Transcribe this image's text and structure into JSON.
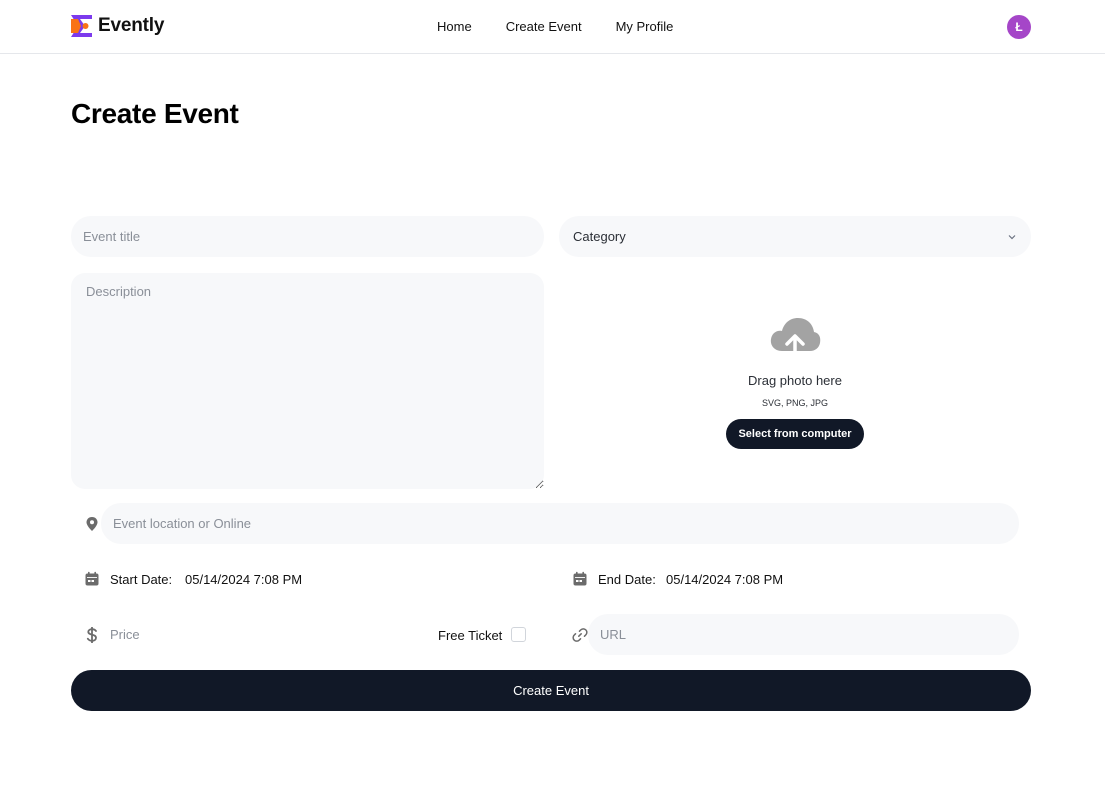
{
  "app": {
    "brand": "Evently",
    "brand_colors": [
      "#f97316",
      "#7c3aed"
    ],
    "nav": [
      {
        "label": "Home"
      },
      {
        "label": "Create Event"
      },
      {
        "label": "My Profile"
      }
    ],
    "avatar_initial": "Ł",
    "avatar_color": "#a546c8"
  },
  "page": {
    "title": "Create Event"
  },
  "form": {
    "title_placeholder": "Event title",
    "category_label": "Category",
    "description_placeholder": "Description",
    "upload": {
      "icon": "cloud-upload-icon",
      "drag_text": "Drag photo here",
      "formats": "SVG, PNG, JPG",
      "button_label": "Select from computer"
    },
    "location_placeholder": "Event location or Online",
    "start_date_label": "Start Date:",
    "start_date_value": "05/14/2024 7:08 PM",
    "end_date_label": "End Date:",
    "end_date_value": "05/14/2024 7:08 PM",
    "price_placeholder": "Price",
    "free_ticket_label": "Free Ticket",
    "free_ticket_checked": false,
    "url_placeholder": "URL",
    "submit_label": "Create Event"
  }
}
